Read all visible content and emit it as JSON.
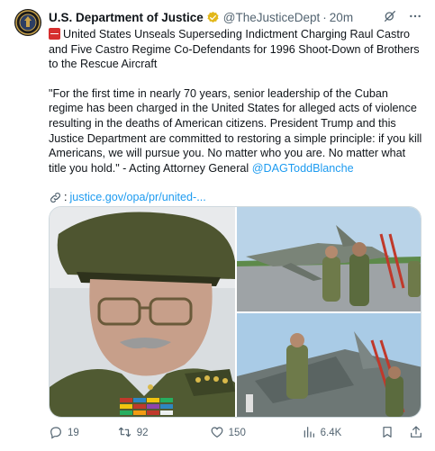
{
  "header": {
    "display_name": "U.S. Department of Justice",
    "handle": "@TheJusticeDept",
    "separator": "·",
    "time": "20m"
  },
  "body": {
    "title": "United States Unseals Superseding Indictment Charging Raul Castro and Five Castro Regime Co-Defendants for 1996 Shoot-Down of Brothers to the Rescue Aircraft",
    "quote": "\"For the first time in nearly 70 years, senior leadership of the Cuban regime has been charged in the United States for alleged acts of violence resulting in the deaths of American citizens. President Trump and this Justice Department are committed to restoring a simple principle: if you kill Americans, we will pursue you. No matter who you are. No matter what title you hold.\" - Acting Attorney General",
    "mention": "@DAGToddBlanche",
    "link_prefix": ":",
    "link_text": "justice.gov/opa/pr/united-..."
  },
  "actions": {
    "replies": "19",
    "reposts": "92",
    "likes": "150",
    "views": "6.4K"
  },
  "colors": {
    "accent": "#1d9bf0",
    "text": "#0f1419",
    "muted": "#536471",
    "verified_gold": "#e2b719",
    "badge_red": "#d62e2e"
  },
  "icons": [
    "doj-seal-icon",
    "verified-badge-icon",
    "grok-icon",
    "more-icon",
    "red-badge-icon",
    "link-icon",
    "reply-icon",
    "repost-icon",
    "like-icon",
    "views-icon",
    "bookmark-icon",
    "share-icon"
  ]
}
